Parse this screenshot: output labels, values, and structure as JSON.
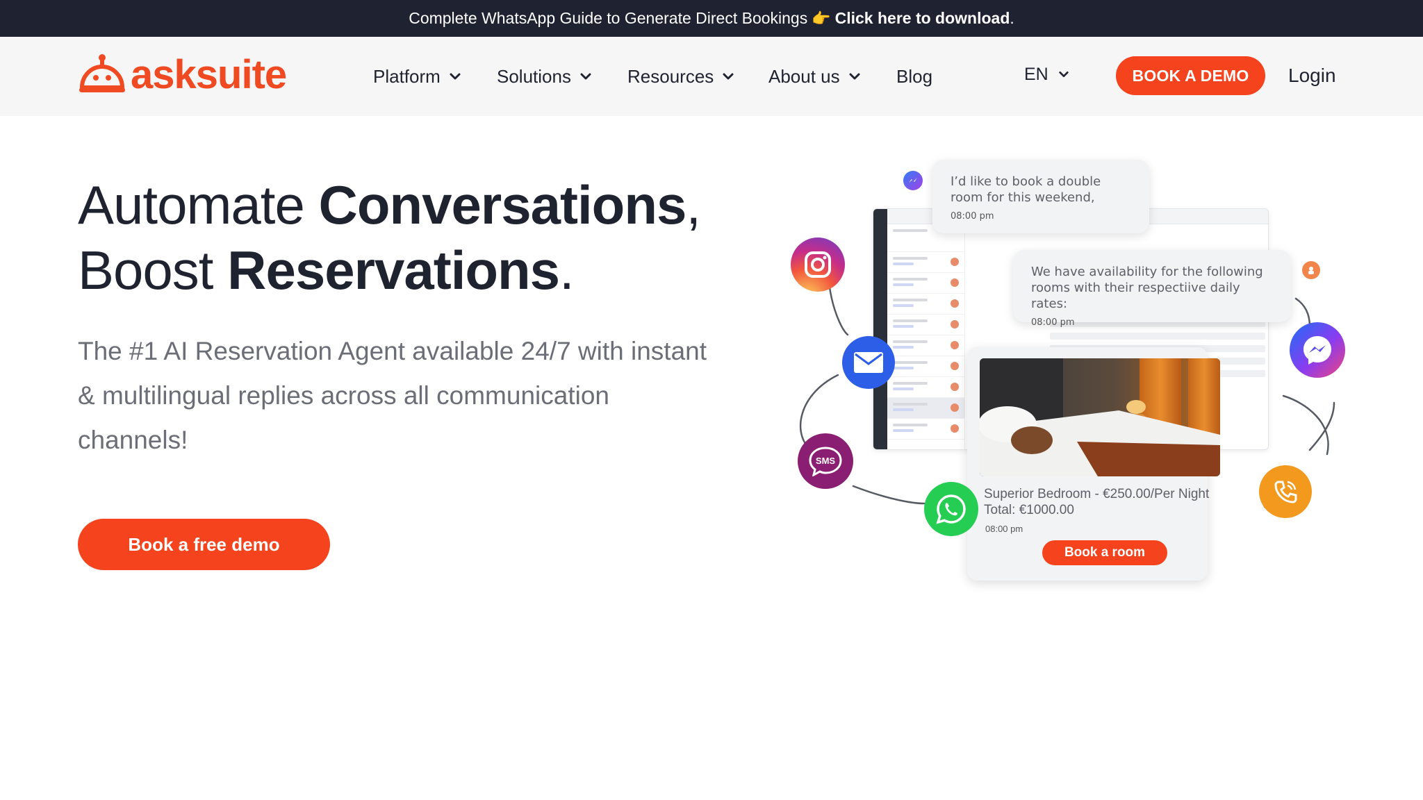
{
  "announcement": {
    "text": "Complete WhatsApp Guide to Generate Direct Bookings",
    "emoji": "👉",
    "link": "Click here to download",
    "suffix": "."
  },
  "header": {
    "logo": "asksuite",
    "nav": [
      {
        "label": "Platform",
        "has_dropdown": true
      },
      {
        "label": "Solutions",
        "has_dropdown": true
      },
      {
        "label": "Resources",
        "has_dropdown": true
      },
      {
        "label": "About us",
        "has_dropdown": true
      },
      {
        "label": "Blog",
        "has_dropdown": false
      }
    ],
    "language": "EN",
    "demo_button": "BOOK A DEMO",
    "login": "Login"
  },
  "hero": {
    "headline_line1_light": "Automate ",
    "headline_line1_bold": "Conversations",
    "headline_line1_end": ",",
    "headline_line2_light": "Boost ",
    "headline_line2_bold": "Reservations",
    "headline_line2_end": ".",
    "subheadline": "The #1 AI Reservation Agent available 24/7 with instant & multilingual replies across all communication channels!",
    "cta": "Book a free demo"
  },
  "illustration": {
    "message_guest": "I’d like to book a double room for this weekend,",
    "message_guest_time": "08:00 pm",
    "message_bot": "We have availability for the following rooms with their respectiive daily rates:",
    "message_bot_time": "08:00 pm",
    "room_title": "Superior Bedroom - €250.00/Per Night",
    "room_total": "Total: €1000.00",
    "room_time": "08:00 pm",
    "room_button": "Book a room",
    "sms_label": "SMS",
    "channels": [
      "instagram-icon",
      "email-icon",
      "sms-icon",
      "whatsapp-icon",
      "messenger-icon",
      "phone-icon"
    ]
  },
  "colors": {
    "brand_orange": "#f5431e",
    "topbar_bg": "#1e2231",
    "header_bg": "#f6f6f7"
  }
}
